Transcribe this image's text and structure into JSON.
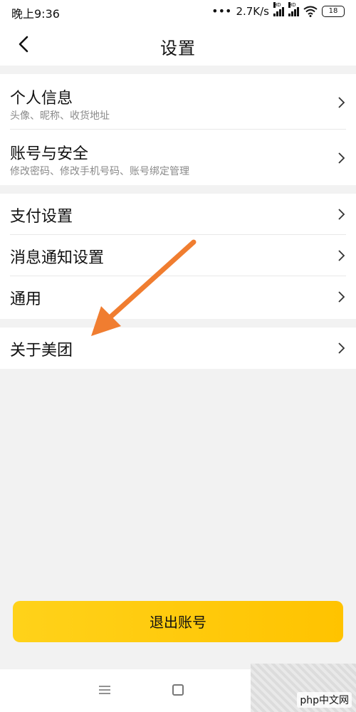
{
  "status_bar": {
    "time": "晚上9:36",
    "network_speed": "2.7K/s",
    "battery_level": "18",
    "hd_label": "HD"
  },
  "header": {
    "title": "设置",
    "back_icon": "chevron-left-icon"
  },
  "groups": [
    {
      "items": [
        {
          "title": "个人信息",
          "subtitle": "头像、昵称、收货地址"
        },
        {
          "title": "账号与安全",
          "subtitle": "修改密码、修改手机号码、账号绑定管理"
        }
      ]
    },
    {
      "items": [
        {
          "title": "支付设置"
        },
        {
          "title": "消息通知设置"
        },
        {
          "title": "通用"
        }
      ]
    },
    {
      "items": [
        {
          "title": "关于美团"
        }
      ]
    }
  ],
  "logout": {
    "label": "退出账号"
  },
  "watermark": {
    "text": "php中文网"
  },
  "colors": {
    "accent_yellow": "#ffc800",
    "annotation_arrow": "#f07d30",
    "background": "#f2f2f2",
    "subtitle_gray": "#8a8a8a"
  }
}
